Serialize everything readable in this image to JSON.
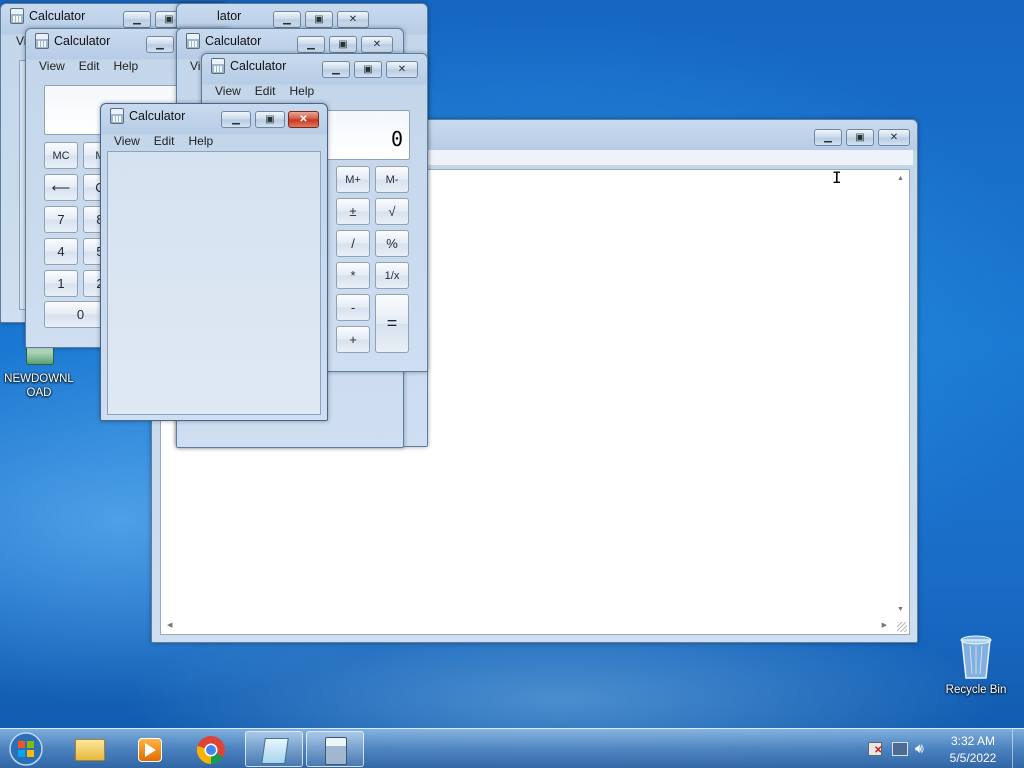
{
  "windows": {
    "calc_title": "Calculator",
    "menu": {
      "view": "View",
      "edit": "Edit",
      "help": "Help"
    },
    "truncated_title": "lator",
    "truncated_menu": "Vi"
  },
  "calculator": {
    "display_value": "0",
    "buttons": {
      "mc": "MC",
      "m": "M",
      "mplus": "M+",
      "mminus": "M-",
      "back": "⟵",
      "c": "C",
      "plusminus": "±",
      "sqrt": "√",
      "divide": "/",
      "percent": "%",
      "multiply": "*",
      "reciprocal": "1/x",
      "minus": "-",
      "plus": "+",
      "equals": "=",
      "seven": "7",
      "eight": "8",
      "four": "4",
      "five": "5",
      "one": "1",
      "two": "2",
      "zero": "0"
    }
  },
  "desktop": {
    "newdownload_label": "NEWDOWNLOAD",
    "newdownload_line1": "NEWDOWNL",
    "newdownload_line2": "OAD",
    "recycle_bin_label": "Recycle Bin"
  },
  "taskbar": {
    "items": [
      "start-orb",
      "windows-explorer",
      "media-player",
      "chrome",
      "notepad",
      "calculator"
    ],
    "time": "3:32 AM",
    "date": "5/5/2022"
  },
  "icons": {
    "minimize": "minimize-icon",
    "maximize": "maximize-icon",
    "close": "close-icon",
    "text_cursor": "text-cursor-icon"
  },
  "colors": {
    "desktop_blue": "#1a78d2",
    "close_red": "#c4351f",
    "window_frame": "#b7cce6"
  }
}
